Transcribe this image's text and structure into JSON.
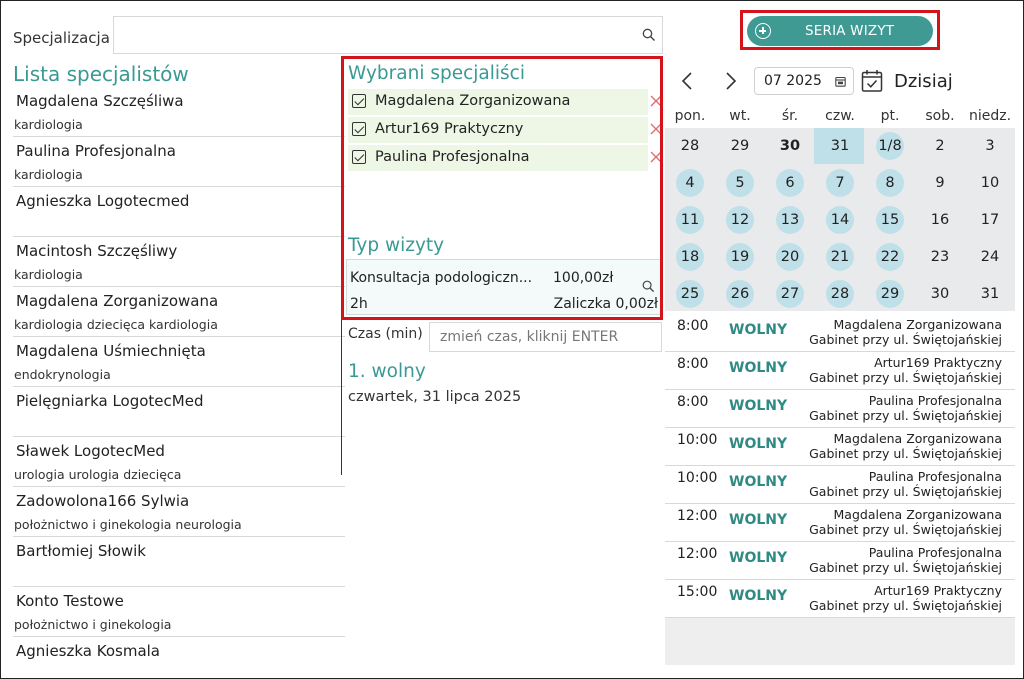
{
  "search": {
    "label": "Specjalizacja",
    "value": ""
  },
  "specialists_list": {
    "title": "Lista specjalistów",
    "items": [
      {
        "name": "Magdalena Szczęśliwa",
        "spec": "kardiologia"
      },
      {
        "name": "Paulina Profesjonalna",
        "spec": "kardiologia"
      },
      {
        "name": "Agnieszka Logotecmed",
        "spec": ""
      },
      {
        "name": "Macintosh Szczęśliwy",
        "spec": "kardiologia"
      },
      {
        "name": "Magdalena Zorganizowana",
        "spec": "kardiologia dziecięca kardiologia"
      },
      {
        "name": "Magdalena Uśmiechnięta",
        "spec": "endokrynologia"
      },
      {
        "name": "Pielęgniarka LogotecMed",
        "spec": ""
      },
      {
        "name": "Sławek LogotecMed",
        "spec": "urologia urologia dziecięca"
      },
      {
        "name": "Zadowolona166 Sylwia",
        "spec": "położnictwo i ginekologia neurologia"
      },
      {
        "name": "Bartłomiej Słowik",
        "spec": ""
      },
      {
        "name": "Konto Testowe",
        "spec": "położnictwo i ginekologia"
      },
      {
        "name": "Agnieszka Kosmala",
        "spec": ""
      }
    ]
  },
  "selected": {
    "title": "Wybrani specjaliści",
    "items": [
      {
        "name": "Magdalena Zorganizowana",
        "checked": true
      },
      {
        "name": "Artur169 Praktyczny",
        "checked": true
      },
      {
        "name": "Paulina Profesjonalna",
        "checked": true
      }
    ]
  },
  "visit_type": {
    "title": "Typ wizyty",
    "name": "Konsultacja podologiczn...",
    "price": "100,00zł",
    "duration": "2h",
    "advance": "Zaliczka 0,00zł"
  },
  "time": {
    "label": "Czas (min)",
    "placeholder": "zmień czas, kliknij ENTER"
  },
  "result": {
    "title": "1. wolny",
    "date": "czwartek, 31 lipca 2025"
  },
  "series_button": {
    "label": "SERIA WIZYT"
  },
  "calendar": {
    "month": "07 2025",
    "today_label": "Dzisiaj",
    "weekdays": [
      "pon.",
      "wt.",
      "śr.",
      "czw.",
      "pt.",
      "sob.",
      "niedz."
    ],
    "weeks": [
      [
        {
          "d": "28"
        },
        {
          "d": "29"
        },
        {
          "d": "30",
          "bold": true
        },
        {
          "d": "31",
          "today": true
        },
        {
          "d": "1/8",
          "avail": true
        },
        {
          "d": "2"
        },
        {
          "d": "3"
        }
      ],
      [
        {
          "d": "4",
          "avail": true
        },
        {
          "d": "5",
          "avail": true
        },
        {
          "d": "6",
          "avail": true
        },
        {
          "d": "7",
          "avail": true
        },
        {
          "d": "8",
          "avail": true
        },
        {
          "d": "9"
        },
        {
          "d": "10"
        }
      ],
      [
        {
          "d": "11",
          "avail": true
        },
        {
          "d": "12",
          "avail": true
        },
        {
          "d": "13",
          "avail": true
        },
        {
          "d": "14",
          "avail": true
        },
        {
          "d": "15",
          "avail": true
        },
        {
          "d": "16"
        },
        {
          "d": "17"
        }
      ],
      [
        {
          "d": "18",
          "avail": true
        },
        {
          "d": "19",
          "avail": true
        },
        {
          "d": "20",
          "avail": true
        },
        {
          "d": "21",
          "avail": true
        },
        {
          "d": "22",
          "avail": true
        },
        {
          "d": "23"
        },
        {
          "d": "24"
        }
      ],
      [
        {
          "d": "25",
          "avail": true
        },
        {
          "d": "26",
          "avail": true
        },
        {
          "d": "27",
          "avail": true
        },
        {
          "d": "28",
          "avail": true
        },
        {
          "d": "29",
          "avail": true
        },
        {
          "d": "30"
        },
        {
          "d": "31"
        }
      ]
    ]
  },
  "slots": [
    {
      "time": "8:00",
      "status": "WOLNY",
      "doctor": "Magdalena Zorganizowana",
      "location": "Gabinet przy ul. Świętojańskiej"
    },
    {
      "time": "8:00",
      "status": "WOLNY",
      "doctor": "Artur169 Praktyczny",
      "location": "Gabinet przy ul. Świętojańskiej"
    },
    {
      "time": "8:00",
      "status": "WOLNY",
      "doctor": "Paulina Profesjonalna",
      "location": "Gabinet przy ul. Świętojańskiej"
    },
    {
      "time": "10:00",
      "status": "WOLNY",
      "doctor": "Magdalena Zorganizowana",
      "location": "Gabinet przy ul. Świętojańskiej"
    },
    {
      "time": "10:00",
      "status": "WOLNY",
      "doctor": "Paulina Profesjonalna",
      "location": "Gabinet przy ul. Świętojańskiej"
    },
    {
      "time": "12:00",
      "status": "WOLNY",
      "doctor": "Magdalena Zorganizowana",
      "location": "Gabinet przy ul. Świętojańskiej"
    },
    {
      "time": "12:00",
      "status": "WOLNY",
      "doctor": "Paulina Profesjonalna",
      "location": "Gabinet przy ul. Świętojańskiej"
    },
    {
      "time": "15:00",
      "status": "WOLNY",
      "doctor": "Artur169 Praktyczny",
      "location": "Gabinet przy ul. Świętojańskiej"
    }
  ],
  "colors": {
    "accent": "#3a9a93",
    "highlight": "#d4141a",
    "available_day": "#bfe0e9",
    "selected_row": "#eef7e6"
  }
}
